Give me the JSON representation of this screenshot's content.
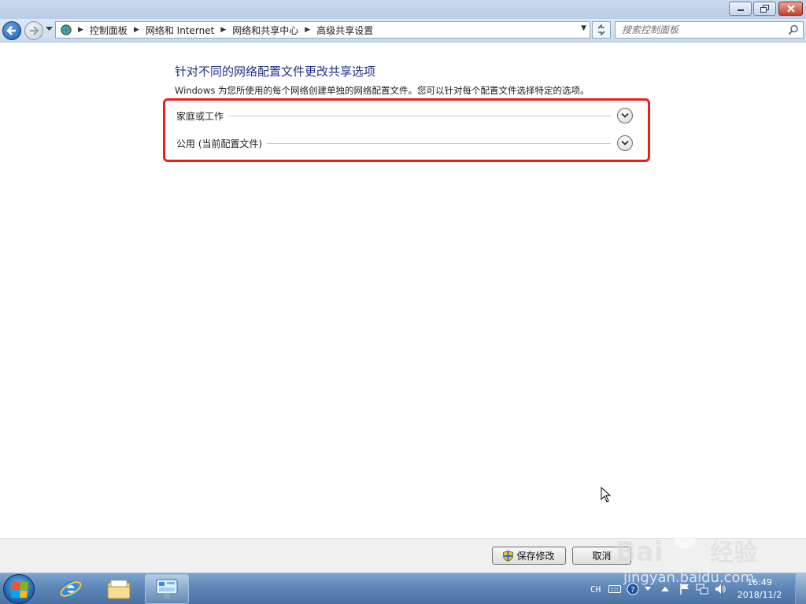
{
  "navigation": {
    "breadcrumb": [
      "控制面板",
      "网络和 Internet",
      "网络和共享中心",
      "高级共享设置"
    ],
    "search_placeholder": "搜索控制面板"
  },
  "main": {
    "title": "针对不同的网络配置文件更改共享选项",
    "description": "Windows 为您所使用的每个网络创建单独的网络配置文件。您可以针对每个配置文件选择特定的选项。",
    "sections": [
      {
        "label": "家庭或工作"
      },
      {
        "label": "公用 (当前配置文件)"
      }
    ]
  },
  "footer": {
    "save_label": "保存修改",
    "cancel_label": "取消"
  },
  "taskbar": {
    "language": "CH",
    "time": "16:49",
    "date": "2018/11/2"
  },
  "colors": {
    "title_blue": "#1e3287",
    "highlight_red": "#e8201a",
    "taskbar_blue": "#5e86b6"
  },
  "watermark": "jingyan.baidu.com"
}
